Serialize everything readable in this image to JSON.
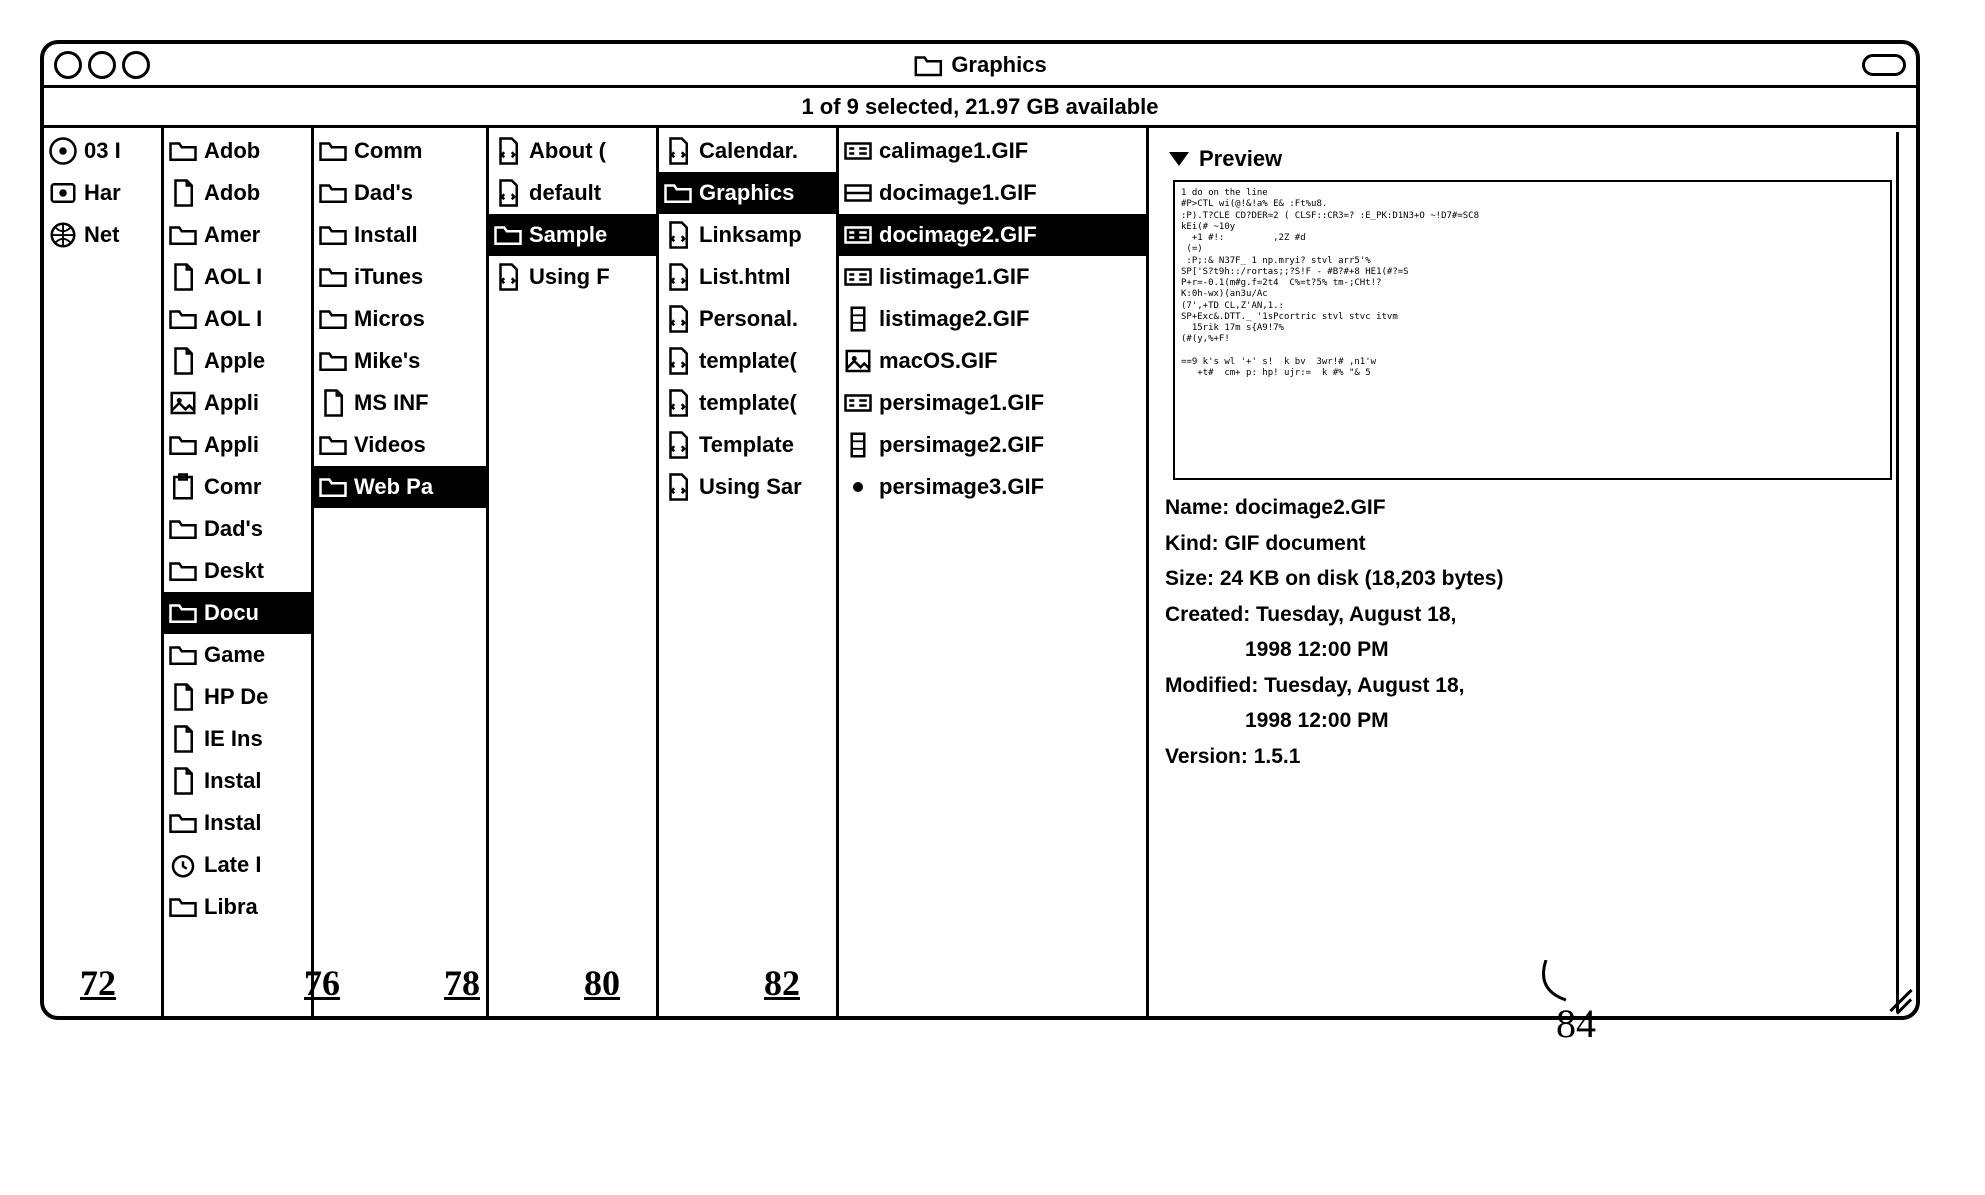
{
  "window": {
    "title": "Graphics",
    "status": "1 of 9 selected, 21.97 GB available"
  },
  "cols": {
    "c1": [
      {
        "ico": "disk",
        "lbl": "03 I"
      },
      {
        "ico": "disk2",
        "lbl": "Har"
      },
      {
        "ico": "globe",
        "lbl": "Net"
      }
    ],
    "c2": [
      {
        "ico": "folder",
        "lbl": "Adob"
      },
      {
        "ico": "doc",
        "lbl": "Adob"
      },
      {
        "ico": "folder",
        "lbl": "Amer"
      },
      {
        "ico": "doc",
        "lbl": "AOL I"
      },
      {
        "ico": "folder",
        "lbl": "AOL I"
      },
      {
        "ico": "doc",
        "lbl": "Apple"
      },
      {
        "ico": "img",
        "lbl": "Appli"
      },
      {
        "ico": "folder",
        "lbl": "Appli"
      },
      {
        "ico": "clip",
        "lbl": "Comr"
      },
      {
        "ico": "folder",
        "lbl": "Dad's"
      },
      {
        "ico": "folder",
        "lbl": "Deskt"
      },
      {
        "ico": "folder",
        "lbl": "Docu",
        "sel": true
      },
      {
        "ico": "folder",
        "lbl": "Game"
      },
      {
        "ico": "doc",
        "lbl": "HP De"
      },
      {
        "ico": "doc",
        "lbl": "IE Ins"
      },
      {
        "ico": "doc",
        "lbl": "Instal"
      },
      {
        "ico": "folder",
        "lbl": "Instal"
      },
      {
        "ico": "time",
        "lbl": "Late I"
      },
      {
        "ico": "folder",
        "lbl": "Libra"
      }
    ],
    "c3": [
      {
        "ico": "folder",
        "lbl": "Comm"
      },
      {
        "ico": "folder",
        "lbl": "Dad's "
      },
      {
        "ico": "folder",
        "lbl": "Install"
      },
      {
        "ico": "folder",
        "lbl": "iTunes"
      },
      {
        "ico": "folder",
        "lbl": "Micros"
      },
      {
        "ico": "folder",
        "lbl": "Mike's"
      },
      {
        "ico": "doc",
        "lbl": "MS INF"
      },
      {
        "ico": "folder",
        "lbl": "Videos"
      },
      {
        "ico": "folder",
        "lbl": "Web Pa",
        "sel": true
      }
    ],
    "c4": [
      {
        "ico": "html",
        "lbl": "About ("
      },
      {
        "ico": "html",
        "lbl": "default"
      },
      {
        "ico": "folder",
        "lbl": "Sample",
        "sel": true
      },
      {
        "ico": "html",
        "lbl": "Using F"
      }
    ],
    "c5": [
      {
        "ico": "html",
        "lbl": "Calendar."
      },
      {
        "ico": "folder",
        "lbl": "Graphics",
        "sel": true
      },
      {
        "ico": "html",
        "lbl": "Linksamp"
      },
      {
        "ico": "html",
        "lbl": "List.html"
      },
      {
        "ico": "html",
        "lbl": "Personal."
      },
      {
        "ico": "html",
        "lbl": "template("
      },
      {
        "ico": "html",
        "lbl": "template("
      },
      {
        "ico": "html",
        "lbl": "Template"
      },
      {
        "ico": "html",
        "lbl": "Using Sar"
      }
    ],
    "c6": [
      {
        "ico": "gif",
        "lbl": "calimage1.GIF"
      },
      {
        "ico": "gif2",
        "lbl": "docimage1.GIF"
      },
      {
        "ico": "gif",
        "lbl": "docimage2.GIF",
        "sel": true
      },
      {
        "ico": "gif",
        "lbl": "listimage1.GIF"
      },
      {
        "ico": "gif3",
        "lbl": "listimage2.GIF"
      },
      {
        "ico": "img",
        "lbl": "macOS.GIF"
      },
      {
        "ico": "gif",
        "lbl": "persimage1.GIF"
      },
      {
        "ico": "gif3",
        "lbl": "persimage2.GIF"
      },
      {
        "ico": "dot",
        "lbl": "persimage3.GIF"
      }
    ]
  },
  "preview": {
    "heading": "Preview",
    "thumb_text": "1 do on the line\n#P>CTL wi(@!&!a% E& :Ft%u8.\n:P).T?CLE CD?DER=2 ( CLSF::CR3=? :E_PK:D1N3+O ~!D7#=SC8\nkEi(# ~10y\n  +1 #!:         ,2Z #d\n (=)\n :P;:& N37F_ 1 np.mryi? stvl arr5'%\nSP['S?t9h::/rortas;;?S!F - #B?#+8 HE1(#?=S\nP+r=-0.1(m#g.f=2t4  C%=t?5% tm-;CHt!?\nK:0h-wx)(an3u/Ac\n(7',+TD CL,Z'AN,1.:\nSP+Exc&.DTT._ '1sPcortric stvl stvc itvm\n  15rik 17m s{A9!7%\n(#(y,%+F!\n\n==9 k's wl '+' s!  k bv  3wr!# ,n1'w\n   +t#  cm+ p: hp! ujr:=  k #% \"& 5",
    "name": "docimage2.GIF",
    "kind": "GIF document",
    "size": "24 KB on disk (18,203 bytes)",
    "created": "Tuesday, August 18, 1998 12:00 PM",
    "modified": "Tuesday, August 18, 1998 12:00 PM",
    "version": "1.5.1"
  },
  "labels": {
    "name": "Name:",
    "kind": "Kind:",
    "size": "Size:",
    "created": "Created:",
    "modified": "Modified:",
    "version": "Version:"
  },
  "annotations": {
    "c1": "72",
    "c2": "76",
    "c3": "78",
    "c4": "80",
    "c5": "82",
    "preview": "84"
  }
}
